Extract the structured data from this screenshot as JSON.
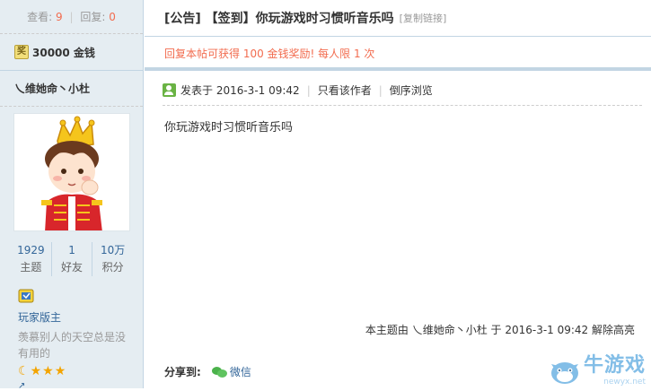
{
  "sidebar": {
    "views_label": "查看:",
    "views_value": "9",
    "replies_label": "回复:",
    "replies_value": "0",
    "separator": "|",
    "reward_icon": "奖",
    "reward_text": "30000 金钱",
    "author_name": "乀维她命丶小杜",
    "counts": [
      {
        "num": "1929",
        "label": "主题"
      },
      {
        "num": "1",
        "label": "好友"
      },
      {
        "num": "10万",
        "label": "积分"
      }
    ],
    "group": "玩家版主",
    "signature": "羡慕别人的天空总是没有用的"
  },
  "post": {
    "title": "[公告] 【签到】你玩游戏时习惯听音乐吗",
    "copy_link": "[复制链接]",
    "reward_notice": "回复本帖可获得 100 金钱奖励! 每人限 1 次",
    "posted_label": "发表于 2016-3-1 09:42",
    "pipe": "|",
    "only_author": "只看该作者",
    "reverse_view": "倒序浏览",
    "content": "你玩游戏时习惯听音乐吗",
    "footnote": "本主题由 乀维她命丶小杜 于 2016-3-1 09:42 解除高亮",
    "share_label": "分享到:",
    "share_wechat": "微信"
  },
  "watermark": {
    "brand": "牛游戏",
    "domain": "newyx.net"
  },
  "colors": {
    "accent_red": "#f26c4f",
    "link_blue": "#336699",
    "sidebar_bg": "#e5edf2",
    "border": "#c2d5e3"
  }
}
